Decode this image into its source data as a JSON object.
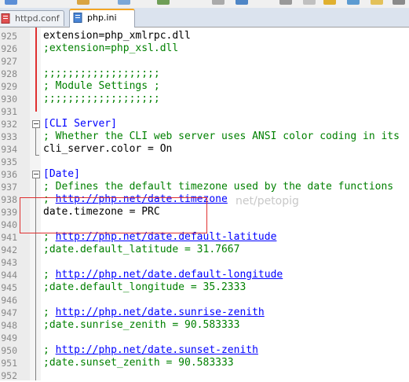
{
  "tabs": [
    {
      "label": "httpd.conf",
      "active": false,
      "dirty": true
    },
    {
      "label": "php.ini",
      "active": true,
      "dirty": false
    }
  ],
  "colors": {
    "accent": "#f5a623",
    "annotation": "#e03030",
    "comment": "#008000",
    "section": "#0000ff"
  },
  "watermark": "net/petopig",
  "lines": [
    {
      "n": "925",
      "kind": "plain",
      "text": "extension=php_xmlrpc.dll"
    },
    {
      "n": "926",
      "kind": "comment",
      "text": ";extension=php_xsl.dll"
    },
    {
      "n": "927",
      "kind": "empty",
      "text": ""
    },
    {
      "n": "928",
      "kind": "comment",
      "text": ";;;;;;;;;;;;;;;;;;;"
    },
    {
      "n": "929",
      "kind": "comment",
      "text": "; Module Settings ;"
    },
    {
      "n": "930",
      "kind": "comment",
      "text": ";;;;;;;;;;;;;;;;;;;"
    },
    {
      "n": "931",
      "kind": "empty",
      "text": ""
    },
    {
      "n": "932",
      "kind": "section",
      "text": "[CLI Server]"
    },
    {
      "n": "933",
      "kind": "comment",
      "text": "; Whether the CLI web server uses ANSI color coding in its"
    },
    {
      "n": "934",
      "kind": "plain",
      "text": "cli_server.color = On"
    },
    {
      "n": "935",
      "kind": "empty",
      "text": ""
    },
    {
      "n": "936",
      "kind": "section",
      "text": "[Date]"
    },
    {
      "n": "937",
      "kind": "comment",
      "text": "; Defines the default timezone used by the date functions"
    },
    {
      "n": "938",
      "kind": "link",
      "prefix": "; ",
      "text": "http://php.net/date.timezone"
    },
    {
      "n": "939",
      "kind": "plain",
      "text": "date.timezone = PRC"
    },
    {
      "n": "940",
      "kind": "empty",
      "text": ""
    },
    {
      "n": "941",
      "kind": "link",
      "prefix": "; ",
      "text": "http://php.net/date.default-latitude"
    },
    {
      "n": "942",
      "kind": "comment",
      "text": ";date.default_latitude = 31.7667"
    },
    {
      "n": "943",
      "kind": "empty",
      "text": ""
    },
    {
      "n": "944",
      "kind": "link",
      "prefix": "; ",
      "text": "http://php.net/date.default-longitude"
    },
    {
      "n": "945",
      "kind": "comment",
      "text": ";date.default_longitude = 35.2333"
    },
    {
      "n": "946",
      "kind": "empty",
      "text": ""
    },
    {
      "n": "947",
      "kind": "link",
      "prefix": "; ",
      "text": "http://php.net/date.sunrise-zenith"
    },
    {
      "n": "948",
      "kind": "comment",
      "text": ";date.sunrise_zenith = 90.583333"
    },
    {
      "n": "949",
      "kind": "empty",
      "text": ""
    },
    {
      "n": "950",
      "kind": "link",
      "prefix": "; ",
      "text": "http://php.net/date.sunset-zenith"
    },
    {
      "n": "951",
      "kind": "comment",
      "text": ";date.sunset_zenith = 90.583333"
    },
    {
      "n": "952",
      "kind": "empty",
      "text": ""
    }
  ]
}
